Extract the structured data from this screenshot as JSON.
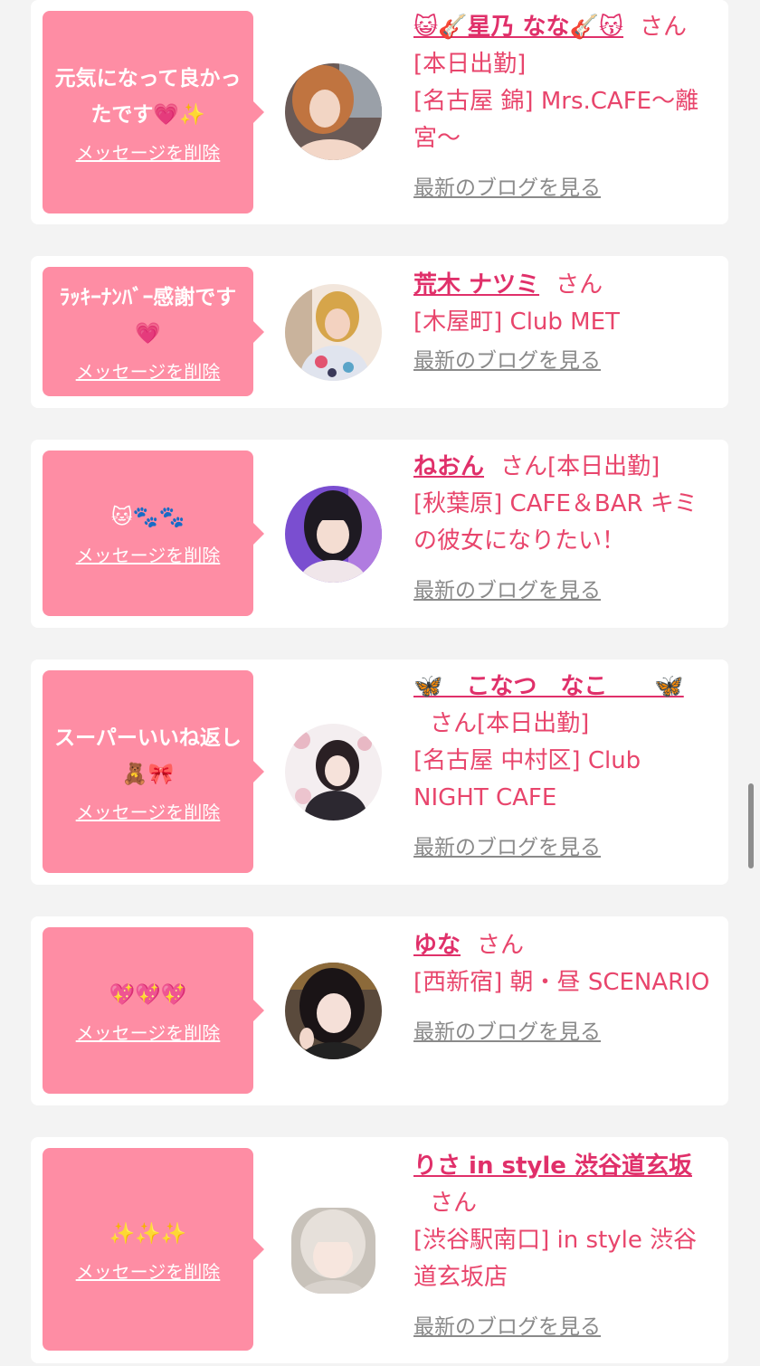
{
  "delete_label": "メッセージを削除",
  "blog_label": "最新のブログを見る",
  "san_label": "さん",
  "colors": {
    "bubble": "#fe8da4",
    "name": "#e0306a",
    "info": "#e8456c",
    "link_gray": "#8a8a8a",
    "background": "#f3f3f3"
  },
  "cards": [
    {
      "message": "元気になって良かったです💗✨",
      "name": "😺🎸星乃 なな🎸😽",
      "status": "[本日出勤]",
      "shop": "[名古屋 錦] Mrs.CAFE〜離宮〜",
      "avatar_icon": "profile-photo"
    },
    {
      "message": "ﾗｯｷｰﾅﾝﾊﾞｰ感謝です💗",
      "name": "荒木 ナツミ",
      "status": "",
      "shop": "[木屋町] Club MET",
      "avatar_icon": "profile-photo"
    },
    {
      "message": "🐱🐾🐾",
      "name": "ねおん",
      "status": "[本日出勤]",
      "shop": "[秋葉原] CAFE＆BAR キミの彼女になりたい！",
      "avatar_icon": "profile-photo"
    },
    {
      "message": "スーパーいいね返し🧸🎀",
      "name": "🦋　こなつ　なこ　　🦋",
      "status": "[本日出勤]",
      "shop": "[名古屋 中村区] Club NIGHT CAFE",
      "avatar_icon": "profile-photo"
    },
    {
      "message": "💖💖💖",
      "name": "ゆな",
      "status": "",
      "shop": "[西新宿] 朝・昼 SCENARIO",
      "avatar_icon": "profile-photo"
    },
    {
      "message": "✨✨✨",
      "name": "りさ in style 渋谷道玄坂",
      "status": "",
      "shop": "[渋谷駅南口] in style 渋谷道玄坂店",
      "avatar_icon": "profile-photo"
    }
  ]
}
